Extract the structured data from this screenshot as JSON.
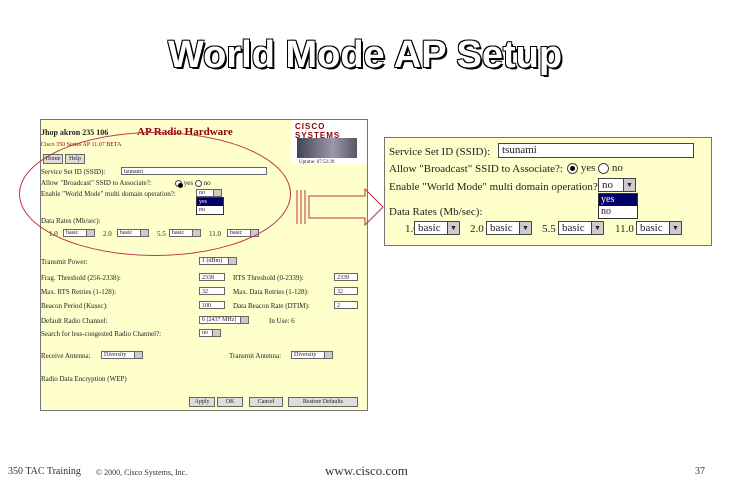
{
  "slide": {
    "title": "World Mode AP Setup",
    "footer_left": "350 TAC Training",
    "footer_copyright": "© 2000, Cisco Systems, Inc.",
    "footer_url": "www.cisco.com",
    "page_number": "37"
  },
  "ap_page": {
    "hostname": "Jhop akron 235 106",
    "heading": "AP Radio Hardware",
    "subheading": "Cisco 350 Series AP 11.07 BETA",
    "logo_text": "CISCO SYSTEMS",
    "uptime": "Uptime: 07:52:39",
    "nav": [
      "Home",
      "Help"
    ],
    "ssid_label": "Service Set ID (SSID):",
    "ssid_value": "tsunami",
    "broadcast_label": "Allow \"Broadcast\" SSID to Associate?:",
    "broadcast_yes": "yes",
    "broadcast_no": "no",
    "world_mode_label": "Enable \"World Mode\" multi domain operation?:",
    "world_mode_value": "no",
    "world_mode_options": [
      "yes",
      "no"
    ],
    "data_rates_label": "Data Rates (Mb/sec):",
    "rates": [
      {
        "rate": "1.0",
        "value": "basic"
      },
      {
        "rate": "2.0",
        "value": "basic"
      },
      {
        "rate": "5.5",
        "value": "basic"
      },
      {
        "rate": "11.0",
        "value": "basic"
      }
    ],
    "transmit_power_label": "Transmit Power:",
    "transmit_power_value": "1 (dBm)",
    "frag_label": "Frag. Threshold (256-2338):",
    "frag_value": "2338",
    "rts_label": "RTS Threshold (0-2339):",
    "rts_value": "2339",
    "max_rts_label": "Max. RTS Retries (1-128):",
    "max_rts_value": "32",
    "max_data_label": "Max. Data Retries (1-128):",
    "max_data_value": "32",
    "beacon_label": "Beacon Period (Kusec):",
    "beacon_value": "100",
    "dtim_label": "Data Beacon Rate (DTIM):",
    "dtim_value": "2",
    "default_radio_label": "Default Radio Channel:",
    "default_radio_value": "6 [2437 MHz]",
    "in_use_label": "In Use: 6",
    "search_label": "Search for less-congested Radio Channel?:",
    "search_value": "no",
    "receive_antenna_label": "Receive Antenna:",
    "receive_antenna_value": "Diversity",
    "transmit_antenna_label": "Transmit Antenna:",
    "transmit_antenna_value": "Diversity",
    "wep_label": "Radio Data Encryption (WEP)",
    "buttons": [
      "Apply",
      "OK",
      "Cancel",
      "Restore Defaults"
    ]
  },
  "zoom_panel": {
    "ssid_label": "Service Set ID (SSID):",
    "ssid_value": "tsunami",
    "broadcast_label": "Allow \"Broadcast\" SSID to Associate?:",
    "yes": "yes",
    "no": "no",
    "world_mode_label": "Enable \"World Mode\" multi domain operation?:",
    "world_mode_value": "no",
    "option_yes": "yes",
    "option_no": "no",
    "data_rates_label": "Data Rates (Mb/sec):",
    "rates": [
      {
        "rate": "1.0",
        "value": "basic"
      },
      {
        "rate": "2.0",
        "value": "basic"
      },
      {
        "rate": "5.5",
        "value": "basic"
      },
      {
        "rate": "11.0",
        "value": "basic"
      }
    ]
  },
  "colors": {
    "panel_bg": "#ffffcc",
    "callout_red": "#c0304a",
    "title_red": "#8b0000"
  }
}
